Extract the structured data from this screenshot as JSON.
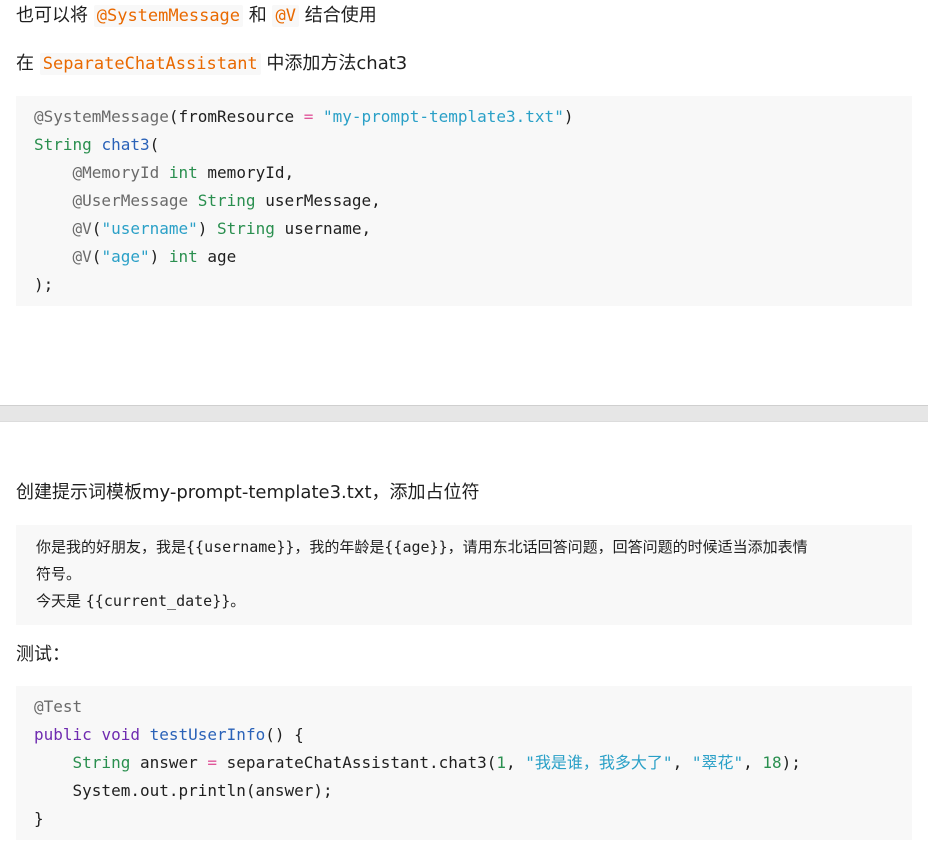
{
  "intro": {
    "prefix": "也可以将 ",
    "code1": "@SystemMessage",
    "mid": " 和 ",
    "code2": "@V",
    "suffix": " 结合使用"
  },
  "add_method": {
    "prefix": "在 ",
    "code": "SeparateChatAssistant",
    "suffix": " 中添加方法chat3"
  },
  "code1": {
    "l1_ann": "@SystemMessage",
    "l1_a": "(fromResource ",
    "l1_op": "=",
    "l1_b": " ",
    "l1_str": "\"my-prompt-template3.txt\"",
    "l1_c": ")",
    "l2_type": "String",
    "l2_a": " ",
    "l2_fn": "chat3",
    "l2_b": "(",
    "l3_indent": "    ",
    "l3_ann": "@MemoryId",
    "l3_a": " ",
    "l3_type": "int",
    "l3_b": " memoryId,",
    "l4_indent": "    ",
    "l4_ann": "@UserMessage",
    "l4_a": " ",
    "l4_type": "String",
    "l4_b": " userMessage,",
    "l5_indent": "    ",
    "l5_ann": "@V",
    "l5_a": "(",
    "l5_str": "\"username\"",
    "l5_b": ") ",
    "l5_type": "String",
    "l5_c": " username,",
    "l6_indent": "    ",
    "l6_ann": "@V",
    "l6_a": "(",
    "l6_str": "\"age\"",
    "l6_b": ") ",
    "l6_type": "int",
    "l6_c": " age",
    "l7": ");"
  },
  "create_template": {
    "text": "创建提示词模板my-prompt-template3.txt，添加占位符"
  },
  "template": {
    "l1_a": "你是我的好朋友，我是",
    "l1_var1": "{{username}}",
    "l1_b": "，我的年龄是",
    "l1_var2": "{{age}}",
    "l1_c": "，请用东北话回答问题，回答问题的时候适当添加表情",
    "l2": "符号。",
    "l3_a": "今天是 ",
    "l3_var": "{{current_date}}",
    "l3_b": "。"
  },
  "test_label": "测试：",
  "code2": {
    "l1_ann": "@Test",
    "l2_kw1": "public",
    "l2_a": " ",
    "l2_kw2": "void",
    "l2_b": " ",
    "l2_fn": "testUserInfo",
    "l2_c": "() {",
    "l3_indent": "    ",
    "l3_type": "String",
    "l3_a": " answer ",
    "l3_op": "=",
    "l3_b": " separateChatAssistant.chat3(",
    "l3_num1": "1",
    "l3_c": ", ",
    "l3_str1": "\"我是谁，我多大了\"",
    "l3_d": ", ",
    "l3_str2": "\"翠花\"",
    "l3_e": ", ",
    "l3_num2": "18",
    "l3_f": ");",
    "l4": "    System.out.println(answer);",
    "l5": "}"
  },
  "colors": {
    "inline_code": "#e96900",
    "string": "#2aa0c7",
    "type": "#2a8f4f",
    "keyword": "#6f2bb0",
    "function": "#2a62b8",
    "annotation": "#6a6a6a",
    "code_bg": "#f8f8f8"
  }
}
